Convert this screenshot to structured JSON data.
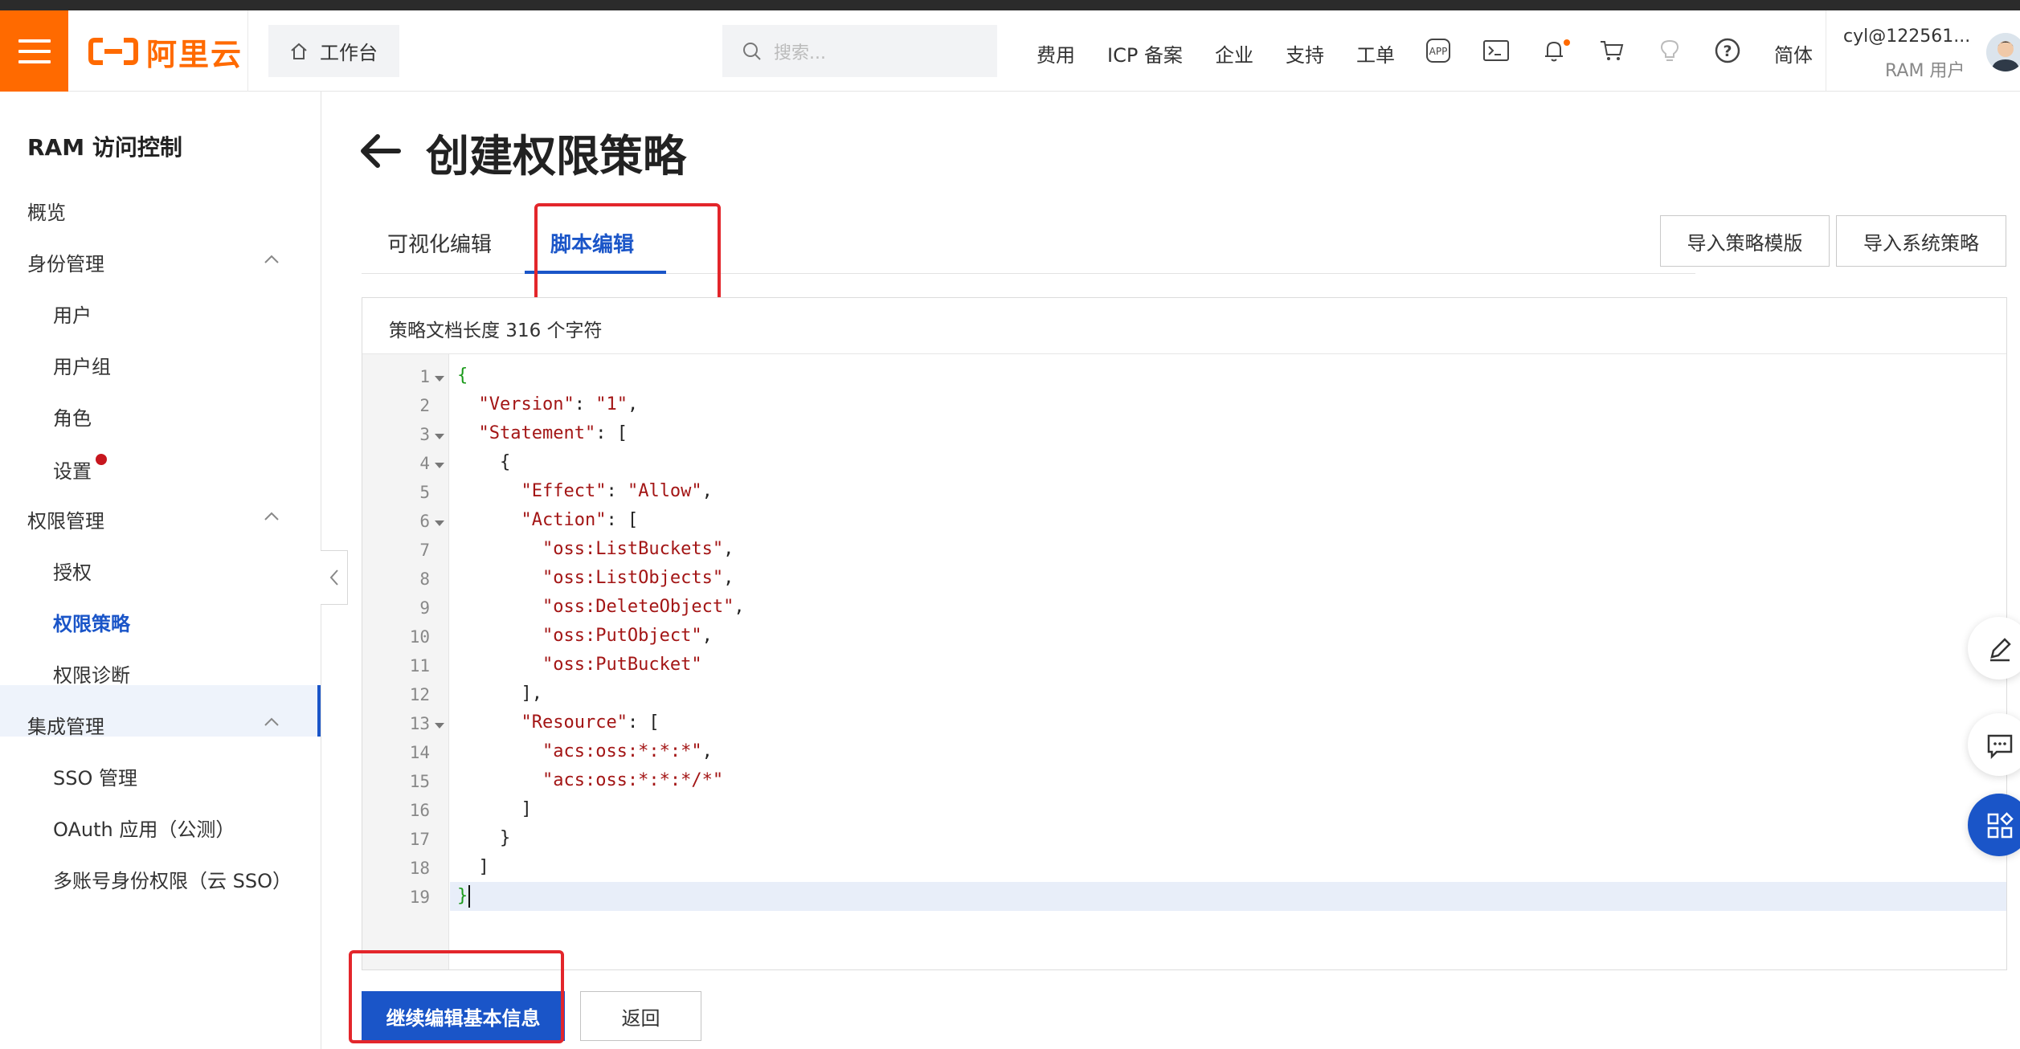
{
  "header": {
    "logo_text": "阿里云",
    "workbench_label": "工作台",
    "search_placeholder": "搜索...",
    "nav": [
      "费用",
      "ICP 备案",
      "企业",
      "支持",
      "工单"
    ],
    "language": "简体",
    "user_name": "cyl@122561...",
    "user_role": "RAM 用户",
    "icons": [
      "app-icon",
      "terminal-icon",
      "bell-icon",
      "cart-icon",
      "bulb-icon",
      "help-icon"
    ],
    "accent_color": "#ff6a00"
  },
  "sidebar": {
    "title": "RAM 访问控制",
    "items": [
      {
        "label": "概览"
      },
      {
        "label": "身份管理",
        "children": [
          "用户",
          "用户组",
          "角色",
          "设置"
        ]
      },
      {
        "label": "权限管理",
        "children": [
          "授权",
          "权限策略",
          "权限诊断"
        ]
      },
      {
        "label": "集成管理",
        "children": [
          "SSO 管理",
          "OAuth 应用（公测）",
          "多账号身份权限（云 SSO）"
        ]
      }
    ],
    "active": "权限策略"
  },
  "page": {
    "title": "创建权限策略",
    "tabs": [
      "可视化编辑",
      "脚本编辑"
    ],
    "active_tab": "脚本编辑",
    "import_template_button": "导入策略模版",
    "import_system_button": "导入系统策略",
    "doc_length_label": "策略文档长度 316 个字符",
    "primary_button": "继续编辑基本信息",
    "back_button": "返回",
    "primary_color": "#1a55c8"
  },
  "editor": {
    "lines": [
      "{",
      "  \"Version\": \"1\",",
      "  \"Statement\": [",
      "    {",
      "      \"Effect\": \"Allow\",",
      "      \"Action\": [",
      "        \"oss:ListBuckets\",",
      "        \"oss:ListObjects\",",
      "        \"oss:DeleteObject\",",
      "        \"oss:PutObject\",",
      "        \"oss:PutBucket\"",
      "      ],",
      "      \"Resource\": [",
      "        \"acs:oss:*:*:*\",",
      "        \"acs:oss:*:*:*/*\"",
      "      ]",
      "    }",
      "  ]",
      "}"
    ],
    "foldable_lines": [
      1,
      3,
      4,
      6,
      13
    ]
  },
  "floating_tools": [
    "edit-icon",
    "feedback-icon",
    "apps-icon"
  ]
}
